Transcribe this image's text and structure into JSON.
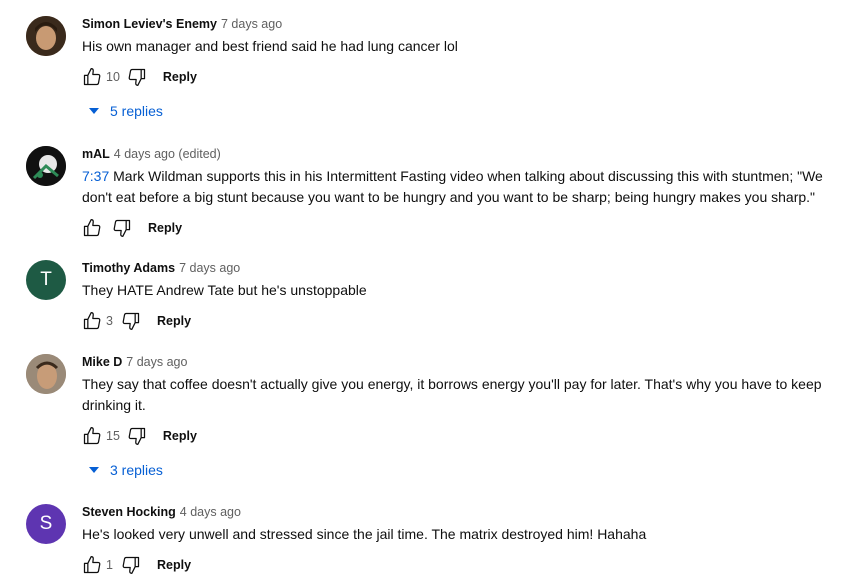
{
  "comments": [
    {
      "author": "Simon Leviev's Enemy",
      "time": "7 days ago",
      "text": "His own manager and best friend said he had lung cancer lol",
      "likes": "10",
      "reply_label": "Reply",
      "replies_label": "5 replies",
      "avatar": {
        "type": "photo",
        "color": "#6b4a2e"
      }
    },
    {
      "author": "mAL",
      "time": "4 days ago (edited)",
      "timestamp": "7:37",
      "text": "Mark Wildman supports this in his Intermittent Fasting video when talking about discussing this with stuntmen; \"We don't eat before a big stunt because you want to be hungry and you want to be sharp; being hungry makes you sharp.\"",
      "likes": "",
      "reply_label": "Reply",
      "avatar": {
        "type": "photo",
        "color": "#111111"
      }
    },
    {
      "author": "Timothy Adams",
      "time": "7 days ago",
      "text": "They HATE Andrew Tate but he's unstoppable",
      "likes": "3",
      "reply_label": "Reply",
      "avatar": {
        "type": "letter",
        "letter": "T",
        "color": "#1e5a44"
      }
    },
    {
      "author": "Mike D",
      "time": "7 days ago",
      "text": "They say that coffee doesn't actually give you energy, it borrows energy you'll pay for later. That's why you have to keep drinking it.",
      "likes": "15",
      "reply_label": "Reply",
      "replies_label": "3 replies",
      "avatar": {
        "type": "photo",
        "color": "#8a7560"
      }
    },
    {
      "author": "Steven Hocking",
      "time": "4 days ago",
      "text": "He's looked very unwell and stressed since the jail time. The matrix destroyed him! Hahaha",
      "likes": "1",
      "reply_label": "Reply",
      "avatar": {
        "type": "letter",
        "letter": "S",
        "color": "#5e35b1"
      }
    }
  ],
  "colors": {
    "link": "#065fd4",
    "secondary_text": "#606060"
  },
  "icons": {
    "like": "thumbs-up-icon",
    "dislike": "thumbs-down-icon",
    "expand": "triangle-down-icon"
  }
}
